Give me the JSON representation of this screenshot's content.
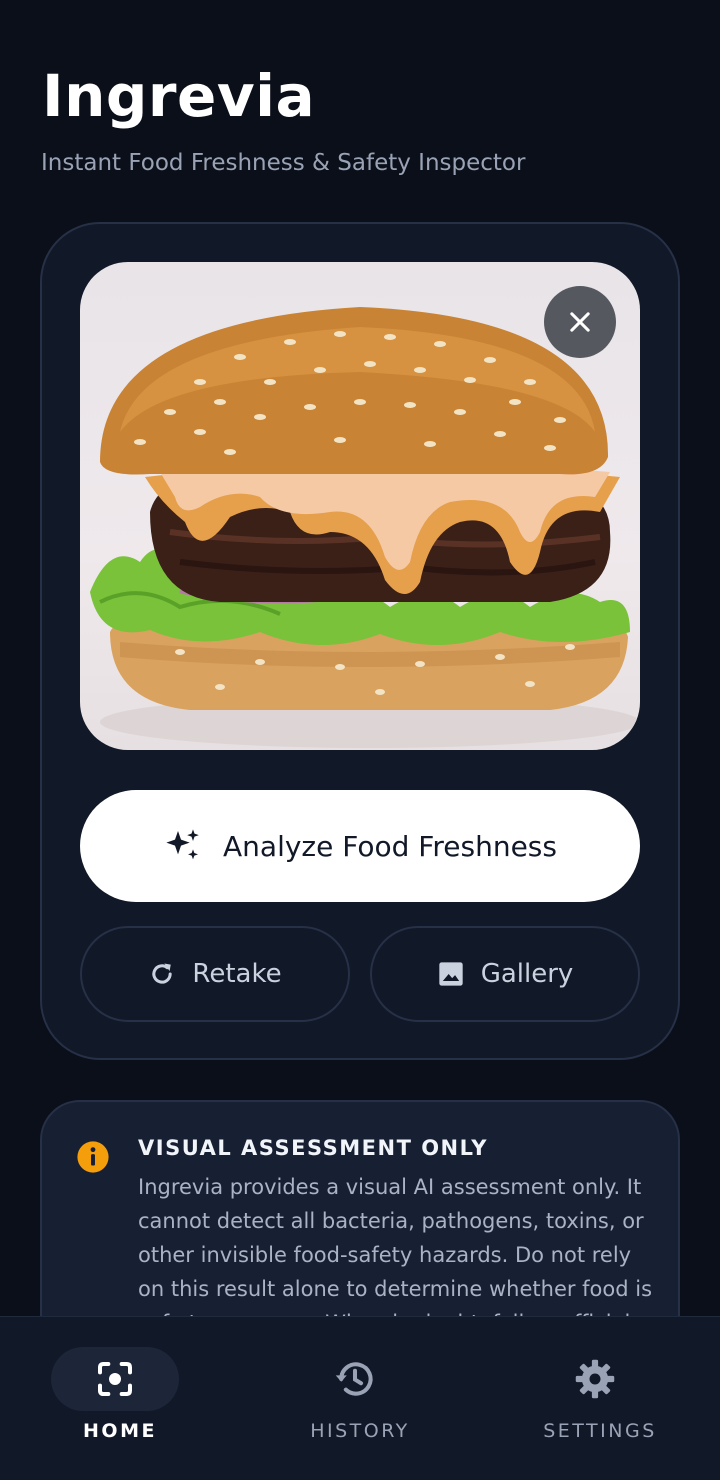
{
  "app": {
    "title": "Ingrevia",
    "subtitle": "Instant Food Freshness & Safety Inspector"
  },
  "capture": {
    "image_subject": "burger-photo",
    "close_icon": "close-icon",
    "analyze_label": "Analyze Food Freshness",
    "analyze_icon": "sparkles-icon",
    "retake_label": "Retake",
    "retake_icon": "refresh-icon",
    "gallery_label": "Gallery",
    "gallery_icon": "image-icon"
  },
  "notice": {
    "icon": "info-icon",
    "title": "VISUAL ASSESSMENT ONLY",
    "body": "Ingrevia provides a visual AI assessment only. It cannot detect all bacteria, pathogens, toxins, or other invisible food-safety hazards. Do not rely on this result alone to determine whether food is safe to consume. When in doubt, follow official"
  },
  "nav": {
    "items": [
      {
        "label": "HOME",
        "icon": "scan-icon",
        "active": true
      },
      {
        "label": "HISTORY",
        "icon": "history-icon",
        "active": false
      },
      {
        "label": "SETTINGS",
        "icon": "gear-icon",
        "active": false
      }
    ]
  },
  "colors": {
    "background": "#0b0f19",
    "card": "#111827",
    "notice_card": "#172033",
    "accent_info": "#f59e0b"
  }
}
